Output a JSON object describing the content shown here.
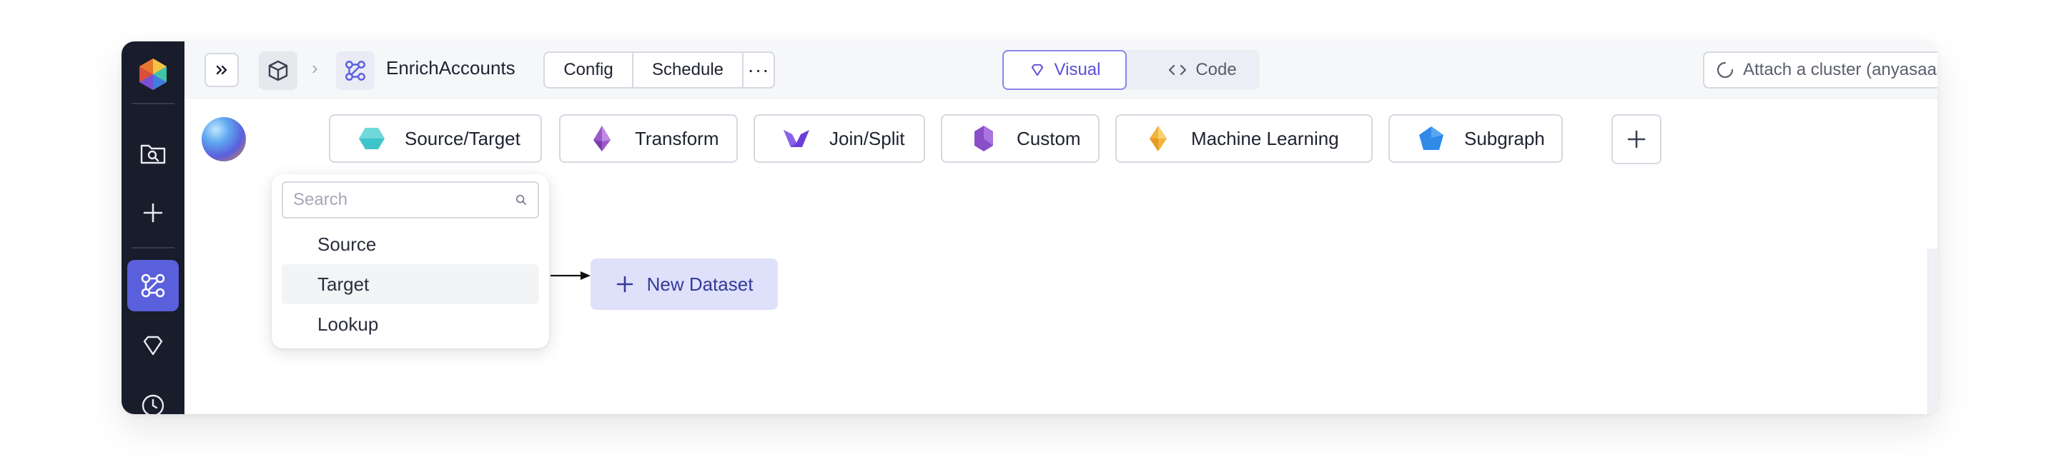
{
  "sidebar": {
    "logo_icon": "prophecy-logo-icon",
    "items": [
      {
        "icon": "folder-search-icon",
        "active": false
      },
      {
        "icon": "plus-icon",
        "active": false
      },
      {
        "icon": "pipeline-icon",
        "active": true
      },
      {
        "icon": "gem-icon",
        "active": false
      },
      {
        "icon": "clock-icon",
        "active": false
      }
    ]
  },
  "topbar": {
    "pipeline_name": "EnrichAccounts",
    "config_label": "Config",
    "schedule_label": "Schedule",
    "more_label": "···",
    "visual_label": "Visual",
    "code_label": "Code",
    "cluster_label": "Attach a cluster (anyasaas)"
  },
  "gem_bar": {
    "categories": [
      {
        "label": "Source/Target",
        "icon": "hexagon-icon",
        "color": "#3fc4c8"
      },
      {
        "label": "Transform",
        "icon": "crystal-icon",
        "color": "#9b59c8"
      },
      {
        "label": "Join/Split",
        "icon": "join-split-icon",
        "color": "#6a3fd6"
      },
      {
        "label": "Custom",
        "icon": "hexagon-icon",
        "color": "#8a4fc8"
      },
      {
        "label": "Machine Learning",
        "icon": "diamond-icon",
        "color": "#f2b33a"
      },
      {
        "label": "Subgraph",
        "icon": "pentagon-icon",
        "color": "#2f8ae8"
      }
    ]
  },
  "dropdown": {
    "search_placeholder": "Search",
    "items": [
      {
        "label": "Source",
        "hover": false
      },
      {
        "label": "Target",
        "hover": true
      },
      {
        "label": "Lookup",
        "hover": false
      }
    ]
  },
  "canvas": {
    "new_dataset_label": "New Dataset"
  },
  "colors": {
    "sidebar_bg": "#181c2b",
    "accent": "#5a5fdc",
    "new_dataset_bg": "#dfe1fb"
  }
}
